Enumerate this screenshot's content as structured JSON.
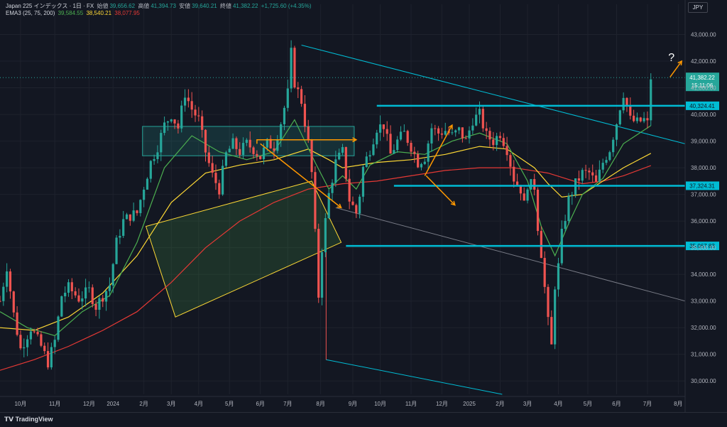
{
  "header": {
    "symbol": "Japan 225 インデックス · 1日 · FX",
    "open_label": "始値",
    "open_value": "39,656.62",
    "high_label": "高値",
    "high_value": "41,394.73",
    "low_label": "安値",
    "low_value": "39,640.21",
    "close_label": "終値",
    "close_value": "41,382.22",
    "change": "+1,725.60 (+4.35%)",
    "ema_label": "EMA3 (25, 75, 200)",
    "ema25": "39,584.55",
    "ema75": "38,540.21",
    "ema200": "38,077.95",
    "currency": "JPY"
  },
  "footer": {
    "brand": "TradingView"
  },
  "colors": {
    "bg": "#131722",
    "up": "#26a69a",
    "down": "#ef5350",
    "ema25": "#4caf50",
    "ema75": "#fdd835",
    "ema200": "#e53935",
    "cyan": "#00bcd4",
    "orange": "#ff9800"
  },
  "chart_data": {
    "type": "candlestick",
    "title": "Japan 225 インデックス · 1日 · FX",
    "ylim": [
      29500,
      43600
    ],
    "y_ticks": [
      30000,
      31000,
      32000,
      33000,
      34000,
      35000,
      36000,
      37000,
      38000,
      39000,
      40000,
      41000,
      42000,
      43000
    ],
    "y_tick_labels": [
      "30,000.00",
      "31,000.00",
      "32,000.00",
      "33,000.00",
      "34,000.00",
      "35,000.00",
      "36,000.00",
      "37,000.00",
      "38,000.00",
      "39,000.00",
      "40,000.00",
      "41,000.00",
      "42,000.00",
      "43,000.00"
    ],
    "x_labels": [
      {
        "t": 0.03,
        "label": "10月"
      },
      {
        "t": 0.08,
        "label": "11月"
      },
      {
        "t": 0.13,
        "label": "12月"
      },
      {
        "t": 0.165,
        "label": "2024"
      },
      {
        "t": 0.21,
        "label": "2月"
      },
      {
        "t": 0.25,
        "label": "3月"
      },
      {
        "t": 0.29,
        "label": "4月"
      },
      {
        "t": 0.335,
        "label": "5月"
      },
      {
        "t": 0.38,
        "label": "6月"
      },
      {
        "t": 0.42,
        "label": "7月"
      },
      {
        "t": 0.468,
        "label": "8月"
      },
      {
        "t": 0.515,
        "label": "9月"
      },
      {
        "t": 0.555,
        "label": "10月"
      },
      {
        "t": 0.6,
        "label": "11月"
      },
      {
        "t": 0.645,
        "label": "12月"
      },
      {
        "t": 0.685,
        "label": "2025"
      },
      {
        "t": 0.73,
        "label": "2月"
      },
      {
        "t": 0.77,
        "label": "3月"
      },
      {
        "t": 0.815,
        "label": "4月"
      },
      {
        "t": 0.858,
        "label": "5月"
      },
      {
        "t": 0.9,
        "label": "6月"
      },
      {
        "t": 0.945,
        "label": "7月"
      },
      {
        "t": 0.99,
        "label": "8月"
      }
    ],
    "close_path": [
      [
        0.0,
        33000
      ],
      [
        0.01,
        34300
      ],
      [
        0.02,
        32500
      ],
      [
        0.03,
        31200
      ],
      [
        0.045,
        32000
      ],
      [
        0.06,
        31300
      ],
      [
        0.07,
        30700
      ],
      [
        0.08,
        31500
      ],
      [
        0.09,
        33200
      ],
      [
        0.1,
        33500
      ],
      [
        0.115,
        33100
      ],
      [
        0.13,
        33400
      ],
      [
        0.14,
        32800
      ],
      [
        0.15,
        33200
      ],
      [
        0.16,
        33600
      ],
      [
        0.17,
        35200
      ],
      [
        0.18,
        36000
      ],
      [
        0.19,
        36200
      ],
      [
        0.2,
        36300
      ],
      [
        0.21,
        37300
      ],
      [
        0.22,
        38200
      ],
      [
        0.23,
        38800
      ],
      [
        0.24,
        39600
      ],
      [
        0.25,
        40000
      ],
      [
        0.26,
        39500
      ],
      [
        0.27,
        40800
      ],
      [
        0.28,
        40200
      ],
      [
        0.29,
        39800
      ],
      [
        0.3,
        38600
      ],
      [
        0.31,
        37700
      ],
      [
        0.32,
        37200
      ],
      [
        0.33,
        38500
      ],
      [
        0.34,
        38900
      ],
      [
        0.35,
        38600
      ],
      [
        0.36,
        38900
      ],
      [
        0.37,
        38700
      ],
      [
        0.38,
        38400
      ],
      [
        0.39,
        38900
      ],
      [
        0.4,
        38800
      ],
      [
        0.41,
        39700
      ],
      [
        0.42,
        40800
      ],
      [
        0.425,
        42300
      ],
      [
        0.43,
        41200
      ],
      [
        0.44,
        40500
      ],
      [
        0.45,
        38900
      ],
      [
        0.455,
        37800
      ],
      [
        0.46,
        35500
      ],
      [
        0.465,
        33200
      ],
      [
        0.47,
        35000
      ],
      [
        0.48,
        37000
      ],
      [
        0.49,
        38200
      ],
      [
        0.5,
        38600
      ],
      [
        0.51,
        36800
      ],
      [
        0.52,
        36300
      ],
      [
        0.525,
        37000
      ],
      [
        0.53,
        38000
      ],
      [
        0.54,
        38700
      ],
      [
        0.55,
        39500
      ],
      [
        0.56,
        39600
      ],
      [
        0.57,
        38500
      ],
      [
        0.58,
        39000
      ],
      [
        0.59,
        39300
      ],
      [
        0.6,
        38800
      ],
      [
        0.61,
        38200
      ],
      [
        0.62,
        38400
      ],
      [
        0.63,
        39500
      ],
      [
        0.64,
        39300
      ],
      [
        0.65,
        39400
      ],
      [
        0.66,
        39200
      ],
      [
        0.67,
        39400
      ],
      [
        0.68,
        39000
      ],
      [
        0.69,
        39800
      ],
      [
        0.7,
        40000
      ],
      [
        0.71,
        39200
      ],
      [
        0.72,
        39000
      ],
      [
        0.73,
        39300
      ],
      [
        0.74,
        38700
      ],
      [
        0.75,
        37600
      ],
      [
        0.76,
        37200
      ],
      [
        0.765,
        36600
      ],
      [
        0.77,
        37400
      ],
      [
        0.78,
        37300
      ],
      [
        0.785,
        35800
      ],
      [
        0.79,
        34800
      ],
      [
        0.795,
        33500
      ],
      [
        0.8,
        32200
      ],
      [
        0.805,
        31300
      ],
      [
        0.81,
        33600
      ],
      [
        0.815,
        34300
      ],
      [
        0.82,
        35500
      ],
      [
        0.83,
        36800
      ],
      [
        0.84,
        37400
      ],
      [
        0.85,
        37800
      ],
      [
        0.86,
        37800
      ],
      [
        0.87,
        37400
      ],
      [
        0.88,
        38200
      ],
      [
        0.89,
        38700
      ],
      [
        0.9,
        39700
      ],
      [
        0.905,
        40300
      ],
      [
        0.91,
        40800
      ],
      [
        0.92,
        39800
      ],
      [
        0.93,
        39700
      ],
      [
        0.94,
        39800
      ],
      [
        0.945,
        39650
      ],
      [
        0.95,
        41380
      ]
    ],
    "ema25_path": [
      [
        0.0,
        32600
      ],
      [
        0.04,
        32000
      ],
      [
        0.08,
        31700
      ],
      [
        0.12,
        32600
      ],
      [
        0.16,
        33200
      ],
      [
        0.2,
        35200
      ],
      [
        0.24,
        38000
      ],
      [
        0.28,
        39200
      ],
      [
        0.32,
        38600
      ],
      [
        0.36,
        38300
      ],
      [
        0.4,
        38600
      ],
      [
        0.43,
        39800
      ],
      [
        0.46,
        38200
      ],
      [
        0.48,
        37200
      ],
      [
        0.5,
        37700
      ],
      [
        0.52,
        37200
      ],
      [
        0.54,
        38100
      ],
      [
        0.58,
        38600
      ],
      [
        0.62,
        38500
      ],
      [
        0.66,
        39000
      ],
      [
        0.7,
        39300
      ],
      [
        0.74,
        38900
      ],
      [
        0.77,
        37500
      ],
      [
        0.79,
        35800
      ],
      [
        0.81,
        34700
      ],
      [
        0.83,
        35900
      ],
      [
        0.85,
        37000
      ],
      [
        0.88,
        37600
      ],
      [
        0.91,
        38900
      ],
      [
        0.95,
        39580
      ]
    ],
    "ema75_path": [
      [
        0.0,
        32000
      ],
      [
        0.05,
        31900
      ],
      [
        0.1,
        32400
      ],
      [
        0.15,
        33300
      ],
      [
        0.2,
        34700
      ],
      [
        0.25,
        36700
      ],
      [
        0.3,
        37800
      ],
      [
        0.35,
        38100
      ],
      [
        0.4,
        38300
      ],
      [
        0.45,
        38700
      ],
      [
        0.48,
        38300
      ],
      [
        0.5,
        38000
      ],
      [
        0.55,
        38200
      ],
      [
        0.6,
        38300
      ],
      [
        0.65,
        38500
      ],
      [
        0.7,
        38800
      ],
      [
        0.74,
        38700
      ],
      [
        0.78,
        38000
      ],
      [
        0.8,
        37400
      ],
      [
        0.82,
        36900
      ],
      [
        0.85,
        37000
      ],
      [
        0.88,
        37500
      ],
      [
        0.91,
        38000
      ],
      [
        0.95,
        38540
      ]
    ],
    "ema200_path": [
      [
        0.0,
        30400
      ],
      [
        0.05,
        30800
      ],
      [
        0.1,
        31300
      ],
      [
        0.15,
        31900
      ],
      [
        0.2,
        32600
      ],
      [
        0.25,
        33700
      ],
      [
        0.3,
        35000
      ],
      [
        0.35,
        36000
      ],
      [
        0.4,
        36700
      ],
      [
        0.45,
        37200
      ],
      [
        0.5,
        37400
      ],
      [
        0.55,
        37500
      ],
      [
        0.6,
        37700
      ],
      [
        0.65,
        37900
      ],
      [
        0.7,
        38000
      ],
      [
        0.75,
        38000
      ],
      [
        0.8,
        37800
      ],
      [
        0.85,
        37400
      ],
      [
        0.88,
        37500
      ],
      [
        0.91,
        37700
      ],
      [
        0.95,
        38080
      ]
    ],
    "horizontal_levels": [
      {
        "value": 40324.41,
        "label": "40,324.41",
        "t_start": 0.55
      },
      {
        "value": 37324.31,
        "label": "37,324.31",
        "t_start": 0.575
      },
      {
        "value": 35067.83,
        "label": "35,067.83",
        "t_start": 0.505
      }
    ],
    "last_price": {
      "value": 41382.22,
      "label": "41,382.22",
      "countdown": "15:11:06"
    },
    "annotation": "?"
  }
}
